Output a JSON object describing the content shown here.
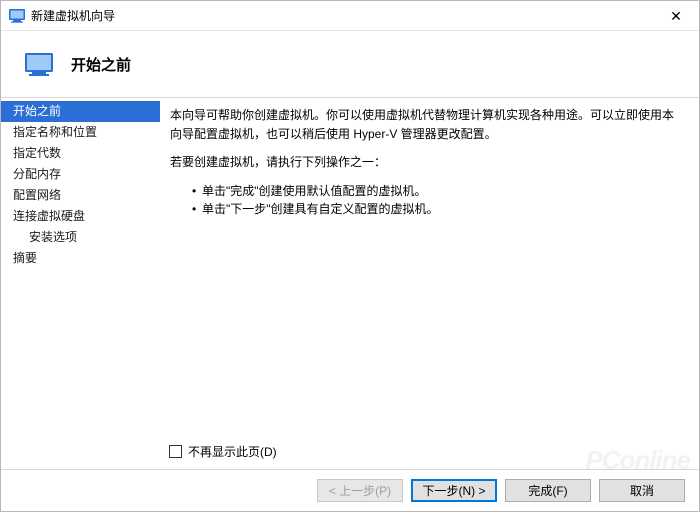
{
  "window": {
    "title": "新建虚拟机向导"
  },
  "header": {
    "title": "开始之前"
  },
  "sidebar": {
    "items": [
      {
        "label": "开始之前",
        "selected": true
      },
      {
        "label": "指定名称和位置"
      },
      {
        "label": "指定代数"
      },
      {
        "label": "分配内存"
      },
      {
        "label": "配置网络"
      },
      {
        "label": "连接虚拟硬盘"
      },
      {
        "label": "安装选项",
        "indent": true
      },
      {
        "label": "摘要"
      }
    ]
  },
  "content": {
    "intro": "本向导可帮助你创建虚拟机。你可以使用虚拟机代替物理计算机实现各种用途。可以立即使用本向导配置虚拟机，也可以稍后使用 Hyper-V 管理器更改配置。",
    "prompt": "若要创建虚拟机，请执行下列操作之一：",
    "bullets": [
      "单击\"完成\"创建使用默认值配置的虚拟机。",
      "单击\"下一步\"创建具有自定义配置的虚拟机。"
    ],
    "checkbox_label": "不再显示此页(D)"
  },
  "footer": {
    "prev": "< 上一步(P)",
    "next": "下一步(N) >",
    "finish": "完成(F)",
    "cancel": "取消"
  },
  "watermark": "PConline"
}
